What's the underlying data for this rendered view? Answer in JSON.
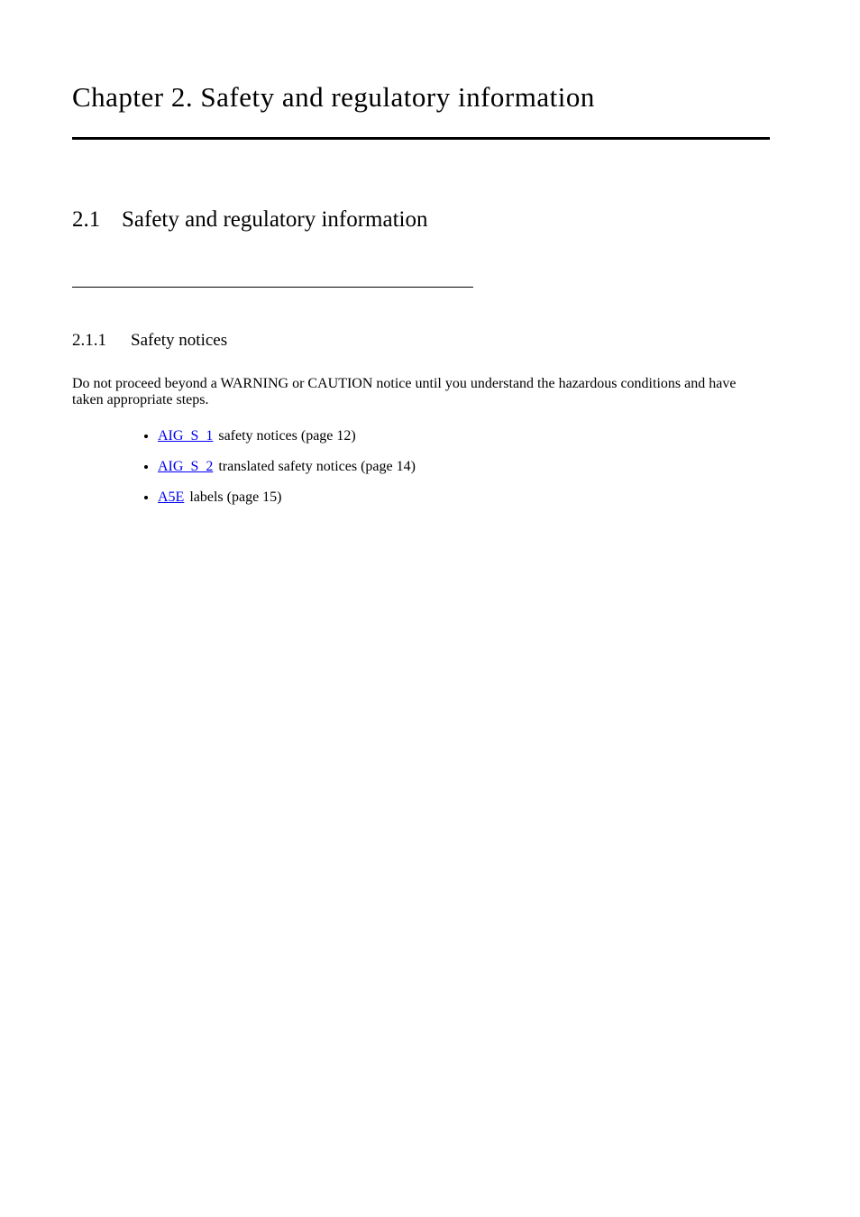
{
  "title": "Chapter 2. Safety and regulatory information",
  "section1": {
    "number": "2.1",
    "title": "Safety and regulatory information"
  },
  "section11": {
    "number": "2.1.1",
    "title": "Safety notices"
  },
  "bodyText": "Do not proceed beyond a WARNING or CAUTION notice until you understand the hazardous conditions and have taken appropriate steps.",
  "references": [
    {
      "code": "AIG_S_1",
      "text": "safety notices (page 12)"
    },
    {
      "code": "AIG_S_2",
      "text": "translated safety notices (page 14)"
    },
    {
      "code": "A5E",
      "text": "labels (page 15)"
    }
  ]
}
